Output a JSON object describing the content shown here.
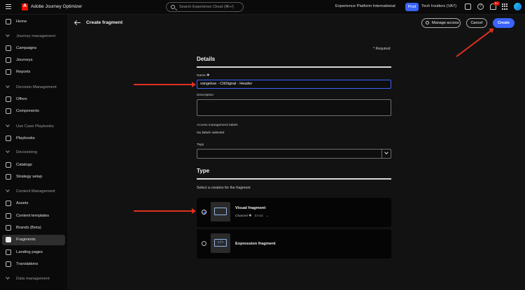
{
  "topbar": {
    "app_name": "Adobe Journey Optimizer",
    "search_placeholder": "Search Experience Cloud (⌘+/)",
    "org": "Experience Platform International",
    "env_badge": "Prod",
    "sandbox": "Tech Insiders (VA7)",
    "notifications": "9+"
  },
  "sidebar": {
    "items": [
      {
        "label": "Home",
        "type": "item"
      },
      {
        "label": "Journey management",
        "type": "section"
      },
      {
        "label": "Campaigns",
        "type": "item"
      },
      {
        "label": "Journeys",
        "type": "item"
      },
      {
        "label": "Reports",
        "type": "item"
      },
      {
        "label": "Decision Management",
        "type": "section"
      },
      {
        "label": "Offers",
        "type": "item"
      },
      {
        "label": "Components",
        "type": "item"
      },
      {
        "label": "Use Case Playbooks",
        "type": "section"
      },
      {
        "label": "Playbooks",
        "type": "item"
      },
      {
        "label": "Decisioning",
        "type": "section"
      },
      {
        "label": "Catalogs",
        "type": "item"
      },
      {
        "label": "Strategy setup",
        "type": "item"
      },
      {
        "label": "Content Management",
        "type": "section"
      },
      {
        "label": "Assets",
        "type": "item"
      },
      {
        "label": "Content templates",
        "type": "item"
      },
      {
        "label": "Brands (Beta)",
        "type": "item"
      },
      {
        "label": "Fragments",
        "type": "item",
        "active": true
      },
      {
        "label": "Landing pages",
        "type": "item"
      },
      {
        "label": "Translations",
        "type": "item"
      },
      {
        "label": "Data management",
        "type": "section"
      }
    ]
  },
  "header": {
    "title": "Create fragment",
    "manage_access": "Manage access",
    "cancel": "Cancel",
    "create": "Create"
  },
  "form": {
    "required_note": "* Required",
    "details_title": "Details",
    "name_label": "Name ✱",
    "name_value": "vangeluw - CitiSignal - Header",
    "description_label": "Description",
    "description_value": "",
    "access_label": "Access management labels",
    "access_value": "No labels selected",
    "tags_label": "Tags",
    "tags_value": "",
    "type_title": "Type",
    "type_subtitle": "Select a creation for the fragment",
    "options": [
      {
        "title": "Visual fragment",
        "channel_label": "Channel ✱",
        "channel_value": "Email",
        "selected": true
      },
      {
        "title": "Expression fragment",
        "selected": false
      }
    ]
  },
  "colors": {
    "accent": "#3b63fb",
    "annotation_arrow": "#e0301e"
  }
}
